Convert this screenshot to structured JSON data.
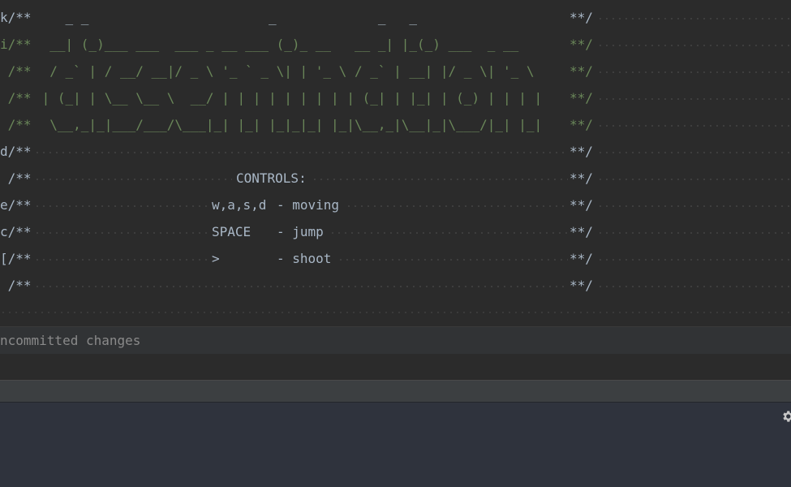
{
  "editor": {
    "lines": [
      {
        "prefix": "k/**",
        "ascii": "    _ _                       _             _   _",
        "end": "**/",
        "style": "gray"
      },
      {
        "prefix": "i/**",
        "ascii": "  __| (_)___ ___  ___ _ __ ___ (_)_ __   __ _| |_(_) ___  _ __",
        "end": "**/",
        "style": "green"
      },
      {
        "prefix": " /**",
        "ascii": "  / _` | / __/ __|/ _ \\ '_ ` _ \\| | '_ \\ / _` | __| |/ _ \\| '_ \\",
        "end": "**/",
        "style": "green"
      },
      {
        "prefix": " /**",
        "ascii": " | (_| | \\__ \\__ \\  __/ | | | | | | | | | (_| | |_| | (_) | | | |",
        "end": "**/",
        "style": "green"
      },
      {
        "prefix": " /**",
        "ascii": "  \\__,_|_|___/___/\\___|_| |_| |_|_|_| |_|\\__,_|\\__|_|\\___/|_| |_|",
        "end": "**/",
        "style": "green"
      },
      {
        "prefix": "d/**",
        "ascii": "",
        "end": "**/",
        "style": "gray"
      }
    ],
    "controls_title": "CONTROLS:",
    "controls": [
      {
        "prefix": "e/**",
        "key": "w,a,s,d",
        "action": "- moving"
      },
      {
        "prefix": "c/**",
        "key": "SPACE",
        "action": "- jump"
      },
      {
        "prefix": "[/**",
        "key": ">",
        "action": "- shoot"
      }
    ],
    "title_prefix": " /**",
    "last_prefix": " /**",
    "end_marker": "**/"
  },
  "panel": {
    "uncommitted_label": "ncommitted changes"
  },
  "tool_window": {
    "settings_icon": "gear-icon"
  },
  "colors": {
    "editor_bg": "#2b2b2b",
    "comment_green": "#6a8759",
    "text_gray": "#a9b7c6"
  }
}
